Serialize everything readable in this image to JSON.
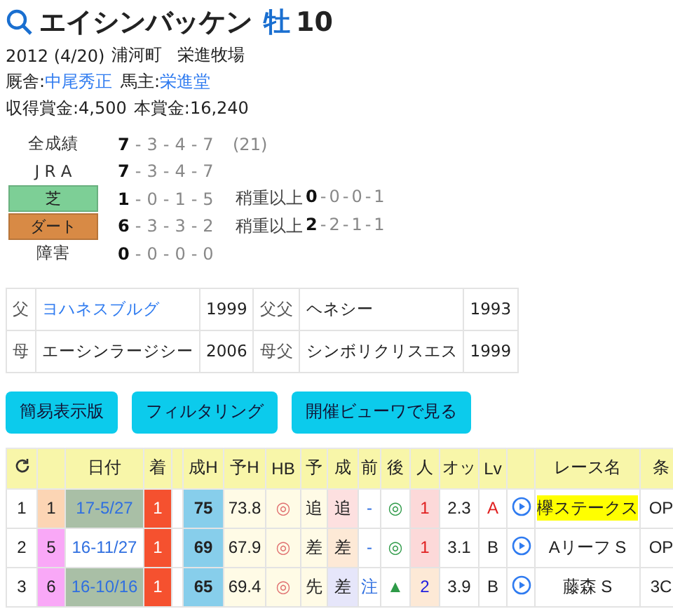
{
  "header": {
    "name": "エイシンバッケン",
    "sex": "牡",
    "age": "10"
  },
  "profile": {
    "birth": "2012 (4/20)",
    "place": "浦河町",
    "breeder": "栄進牧場",
    "trainer_label": "厩舎:",
    "trainer": "中尾秀正",
    "owner_label": "馬主:",
    "owner": "栄進堂",
    "earnings": "収得賞金:4,500",
    "prize": "本賞金:16,240"
  },
  "records": [
    {
      "label": "全成績",
      "kind": "plain",
      "values": [
        "7",
        "-",
        "3",
        "-",
        "4",
        "-",
        "7"
      ],
      "total": "(21)"
    },
    {
      "label": "J R A",
      "kind": "plain",
      "values": [
        "7",
        "-",
        "3",
        "-",
        "4",
        "-",
        "7"
      ]
    },
    {
      "label": "芝",
      "kind": "tag",
      "color": "#7dcf96",
      "values": [
        "1",
        "-",
        "0",
        "-",
        "1",
        "-",
        "5"
      ],
      "heavy_label": "稍重以上",
      "heavy": [
        "0",
        "-",
        "0",
        "-",
        "0",
        "-",
        "1"
      ]
    },
    {
      "label": "ダート",
      "kind": "tag",
      "color": "#d88a45",
      "values": [
        "6",
        "-",
        "3",
        "-",
        "3",
        "-",
        "2"
      ],
      "heavy_label": "稍重以上",
      "heavy": [
        "2",
        "-",
        "2",
        "-",
        "1",
        "-",
        "1"
      ]
    },
    {
      "label": "障害",
      "kind": "plain",
      "values": [
        "0",
        "-",
        "0",
        "-",
        "0",
        "-",
        "0"
      ]
    }
  ],
  "pedigree": [
    [
      {
        "text": "父",
        "kind": "label"
      },
      {
        "text": "ヨハネスブルグ",
        "kind": "link"
      },
      {
        "text": "1999",
        "kind": "value"
      },
      {
        "text": "父父",
        "kind": "label"
      },
      {
        "text": "ヘネシー",
        "kind": "value"
      },
      {
        "text": "1993",
        "kind": "value"
      }
    ],
    [
      {
        "text": "母",
        "kind": "label"
      },
      {
        "text": "エーシンラージシー",
        "kind": "value"
      },
      {
        "text": "2006",
        "kind": "value"
      },
      {
        "text": "母父",
        "kind": "label"
      },
      {
        "text": "シンボリクリスエス",
        "kind": "value"
      },
      {
        "text": "1999",
        "kind": "value"
      }
    ]
  ],
  "buttons": [
    "簡易表示版",
    "フィルタリング",
    "開催ビューワで見る"
  ],
  "table": {
    "columns": [
      {
        "kind": "refresh"
      },
      {
        "kind": "blank"
      },
      {
        "kind": "text",
        "label": "日付"
      },
      {
        "kind": "text",
        "label": "着"
      },
      {
        "kind": "blank"
      },
      {
        "kind": "text",
        "label": "成H"
      },
      {
        "kind": "text",
        "label": "予H"
      },
      {
        "kind": "text",
        "label": "HB"
      },
      {
        "kind": "text",
        "label": "予"
      },
      {
        "kind": "text",
        "label": "成"
      },
      {
        "kind": "text",
        "label": "前"
      },
      {
        "kind": "text",
        "label": "後"
      },
      {
        "kind": "text",
        "label": "人"
      },
      {
        "kind": "text",
        "label": "オッ"
      },
      {
        "kind": "text",
        "label": "Lv"
      },
      {
        "kind": "blank"
      },
      {
        "kind": "text",
        "label": "レース名"
      },
      {
        "kind": "text",
        "label": "条"
      }
    ],
    "rows": [
      {
        "cells": [
          {
            "text": "1"
          },
          {
            "text": "1",
            "color": "#fcd5b4"
          },
          {
            "text": "17-5/27",
            "color": "#a9bfa6"
          },
          {
            "text": "1",
            "color": "#f5512f"
          },
          {
            "kind": "blank"
          },
          {
            "text": "75",
            "color": "#87ceeb"
          },
          {
            "text": "73.8",
            "color": "#fffbe6"
          },
          {
            "text": "◎",
            "color": "#fffbe6"
          },
          {
            "text": "追",
            "color": "#fffbe6"
          },
          {
            "text": "追",
            "color": "#fde0e0"
          },
          {
            "text": "-"
          },
          {
            "text": "◎"
          },
          {
            "text": "1",
            "color": "#fcd9d9",
            "accent": true
          },
          {
            "text": "2.3"
          },
          {
            "text": "A",
            "accent": true
          },
          {
            "kind": "play"
          },
          {
            "text": "欅ステークス",
            "color": "#ffff00"
          },
          {
            "text": "OP"
          }
        ]
      },
      {
        "cells": [
          {
            "text": "2"
          },
          {
            "text": "5",
            "color": "#f9a8f7"
          },
          {
            "text": "16-11/27",
            "color": "#ffffff"
          },
          {
            "text": "1",
            "color": "#f5512f"
          },
          {
            "kind": "blank"
          },
          {
            "text": "69",
            "color": "#87ceeb"
          },
          {
            "text": "67.9",
            "color": "#fffbe6"
          },
          {
            "text": "◎",
            "color": "#fffbe6"
          },
          {
            "text": "差",
            "color": "#fffbe6"
          },
          {
            "text": "差",
            "color": "#fde9d6"
          },
          {
            "text": "-"
          },
          {
            "text": "◎"
          },
          {
            "text": "1",
            "color": "#fcd9d9",
            "accent": true
          },
          {
            "text": "3.1"
          },
          {
            "text": "B",
            "accent": false
          },
          {
            "kind": "play"
          },
          {
            "text": "Aリーフ S"
          },
          {
            "text": "OP"
          }
        ]
      },
      {
        "cells": [
          {
            "text": "3"
          },
          {
            "text": "6",
            "color": "#f9a8f7"
          },
          {
            "text": "16-10/16",
            "color": "#a9bfa6"
          },
          {
            "text": "1",
            "color": "#f5512f"
          },
          {
            "kind": "blank"
          },
          {
            "text": "65",
            "color": "#87ceeb"
          },
          {
            "text": "69.4",
            "color": "#fffbe6"
          },
          {
            "text": "◎",
            "color": "#fffbe6"
          },
          {
            "text": "先",
            "color": "#fffbe6"
          },
          {
            "text": "差",
            "color": "#e6e6fa"
          },
          {
            "text": "注"
          },
          {
            "text": "▲"
          },
          {
            "text": "2",
            "color": "#fde9d6",
            "accent": false
          },
          {
            "text": "3.9"
          },
          {
            "text": "B",
            "accent": false
          },
          {
            "kind": "play"
          },
          {
            "text": "藤森 S"
          },
          {
            "text": "3C"
          }
        ]
      }
    ]
  }
}
